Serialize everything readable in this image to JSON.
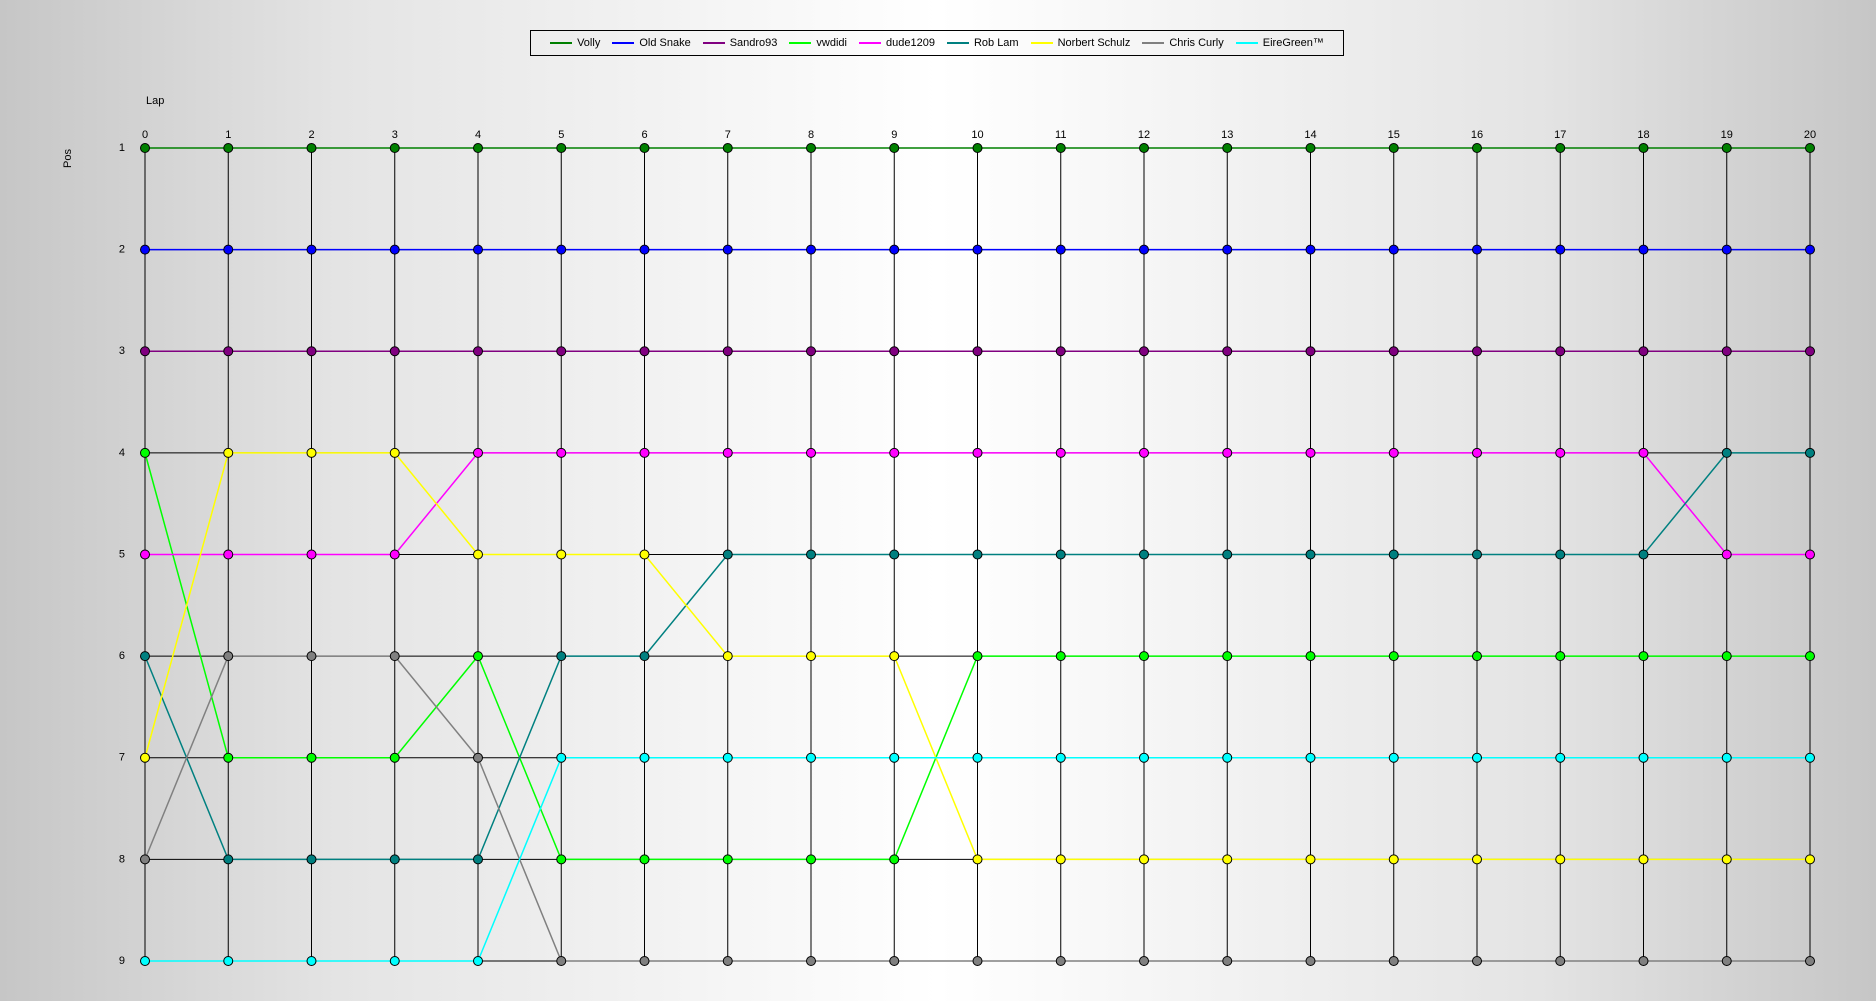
{
  "chart_data": {
    "type": "line",
    "xlabel": "Lap",
    "ylabel": "Pos",
    "x": [
      0,
      1,
      2,
      3,
      4,
      5,
      6,
      7,
      8,
      9,
      10,
      11,
      12,
      13,
      14,
      15,
      16,
      17,
      18,
      19,
      20
    ],
    "xlim": [
      0,
      20
    ],
    "ylim": [
      1,
      9
    ],
    "y_inverted": true,
    "y_ticks": [
      1,
      2,
      3,
      4,
      5,
      6,
      7,
      8,
      9
    ],
    "grid": true,
    "legend_position": "top-center",
    "series": [
      {
        "name": "Volly",
        "color": "#008000",
        "values": [
          1,
          1,
          1,
          1,
          1,
          1,
          1,
          1,
          1,
          1,
          1,
          1,
          1,
          1,
          1,
          1,
          1,
          1,
          1,
          1,
          1
        ]
      },
      {
        "name": "Old Snake",
        "color": "#0000ff",
        "values": [
          2,
          2,
          2,
          2,
          2,
          2,
          2,
          2,
          2,
          2,
          2,
          2,
          2,
          2,
          2,
          2,
          2,
          2,
          2,
          2,
          2
        ]
      },
      {
        "name": "Sandro93",
        "color": "#800080",
        "values": [
          3,
          3,
          3,
          3,
          3,
          3,
          3,
          3,
          3,
          3,
          3,
          3,
          3,
          3,
          3,
          3,
          3,
          3,
          3,
          3,
          3
        ]
      },
      {
        "name": "vwdidi",
        "color": "#00ff00",
        "values": [
          4,
          7,
          7,
          7,
          6,
          8,
          8,
          8,
          8,
          8,
          6,
          6,
          6,
          6,
          6,
          6,
          6,
          6,
          6,
          6,
          6
        ]
      },
      {
        "name": "dude1209",
        "color": "#ff00ff",
        "values": [
          5,
          5,
          5,
          5,
          4,
          4,
          4,
          4,
          4,
          4,
          4,
          4,
          4,
          4,
          4,
          4,
          4,
          4,
          4,
          5,
          5
        ]
      },
      {
        "name": "Rob Lam",
        "color": "#008080",
        "values": [
          6,
          8,
          8,
          8,
          8,
          6,
          6,
          5,
          5,
          5,
          5,
          5,
          5,
          5,
          5,
          5,
          5,
          5,
          5,
          4,
          4
        ]
      },
      {
        "name": "Norbert Schulz",
        "color": "#ffff00",
        "values": [
          7,
          4,
          4,
          4,
          5,
          5,
          5,
          6,
          6,
          6,
          8,
          8,
          8,
          8,
          8,
          8,
          8,
          8,
          8,
          8,
          8
        ]
      },
      {
        "name": "Chris Curly",
        "color": "#808080",
        "values": [
          8,
          6,
          6,
          6,
          7,
          9,
          9,
          9,
          9,
          9,
          9,
          9,
          9,
          9,
          9,
          9,
          9,
          9,
          9,
          9,
          9
        ]
      },
      {
        "name": "EireGreen™",
        "color": "#00ffff",
        "values": [
          9,
          9,
          9,
          9,
          9,
          7,
          7,
          7,
          7,
          7,
          7,
          7,
          7,
          7,
          7,
          7,
          7,
          7,
          7,
          7,
          7
        ]
      }
    ]
  }
}
